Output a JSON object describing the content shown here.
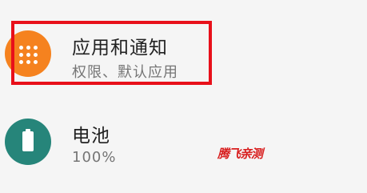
{
  "settings": {
    "items": [
      {
        "title": "应用和通知",
        "subtitle": "权限、默认应用",
        "icon": "apps-grid-icon",
        "icon_color": "#f5821f"
      },
      {
        "title": "电池",
        "subtitle": "100%",
        "icon": "battery-icon",
        "icon_color": "#26857a"
      }
    ]
  },
  "annotation": {
    "highlight_color": "#e8101a"
  },
  "watermark": {
    "text": "腾飞亲测"
  }
}
